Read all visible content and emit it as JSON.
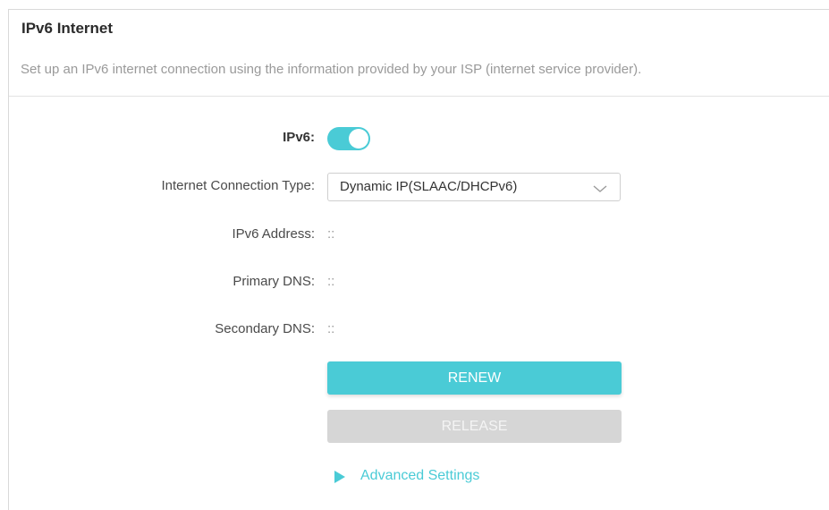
{
  "section": {
    "title": "IPv6 Internet",
    "description": "Set up an IPv6 internet connection using the information provided by your ISP (internet service provider)."
  },
  "ipv6": {
    "label": "IPv6:",
    "enabled": true
  },
  "connection_type": {
    "label": "Internet Connection Type:",
    "selected": "Dynamic IP(SLAAC/DHCPv6)"
  },
  "ipv6_address": {
    "label": "IPv6 Address:",
    "value": "::"
  },
  "primary_dns": {
    "label": "Primary DNS:",
    "value": "::"
  },
  "secondary_dns": {
    "label": "Secondary DNS:",
    "value": "::"
  },
  "buttons": {
    "renew": "RENEW",
    "release": "RELEASE"
  },
  "advanced": {
    "label": "Advanced Settings",
    "icon": "triangle-right-icon"
  },
  "colors": {
    "accent": "#4acbd6",
    "disabled": "#d6d6d6"
  }
}
